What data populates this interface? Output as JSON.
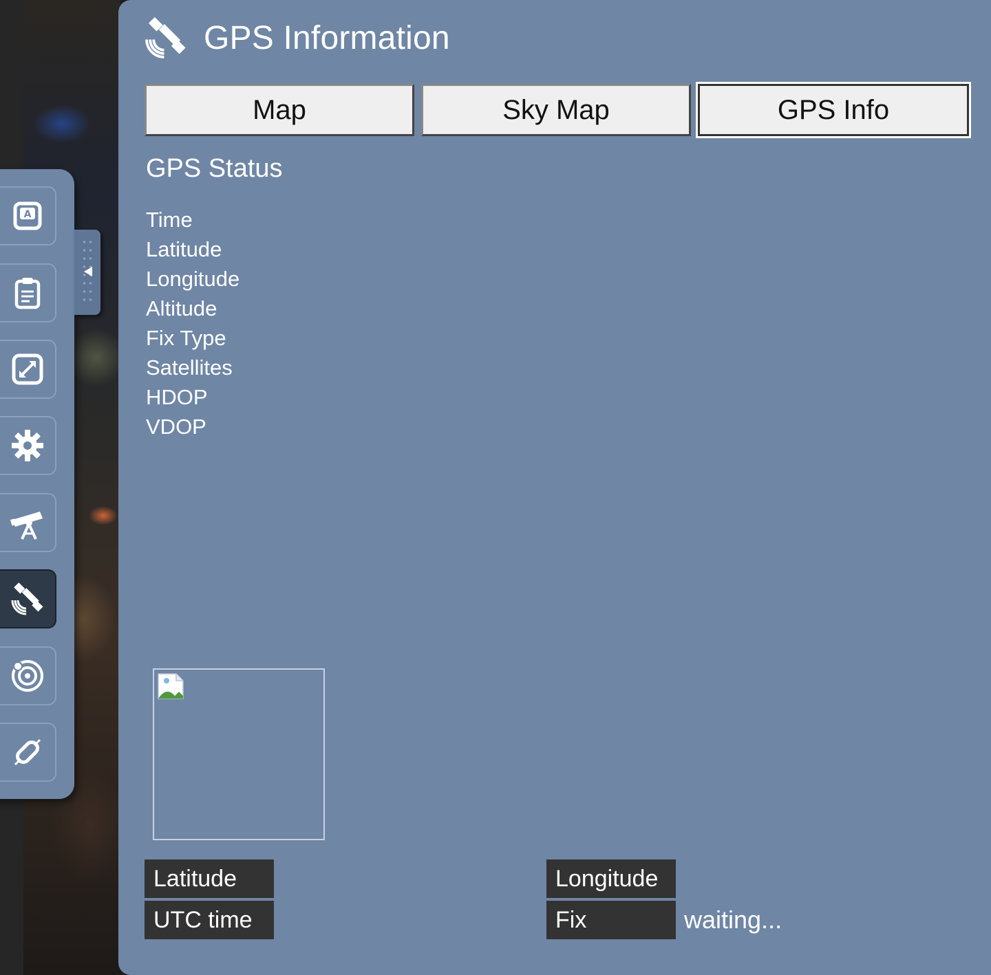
{
  "panel": {
    "title": "GPS Information",
    "icon": "satellite-icon"
  },
  "tabs": [
    {
      "label": "Map",
      "active": false
    },
    {
      "label": "Sky Map",
      "active": false
    },
    {
      "label": "GPS Info",
      "active": true
    }
  ],
  "status": {
    "heading": "GPS Status",
    "rows": [
      "Time",
      "Latitude",
      "Longitude",
      "Altitude",
      "Fix Type",
      "Satellites",
      "HDOP",
      "VDOP"
    ]
  },
  "readouts": {
    "latitude_label": "Latitude",
    "longitude_label": "Longitude",
    "utc_label": "UTC time",
    "fix_label": "Fix",
    "fix_value": "waiting..."
  },
  "toolbar": {
    "items": [
      {
        "icon": "auto-focus-icon",
        "active": false
      },
      {
        "icon": "clipboard-icon",
        "active": false
      },
      {
        "icon": "fullscreen-icon",
        "active": false
      },
      {
        "icon": "gear-icon",
        "active": false
      },
      {
        "icon": "telescope-icon",
        "active": false
      },
      {
        "icon": "satellite-icon",
        "active": true
      },
      {
        "icon": "orbit-icon",
        "active": false
      },
      {
        "icon": "unlink-icon",
        "active": false
      }
    ]
  },
  "colors": {
    "panel_bg": "#6f86a5",
    "label_bg": "#333333",
    "tab_bg": "#efefef",
    "active_tool_bg": "#2f3a48"
  }
}
